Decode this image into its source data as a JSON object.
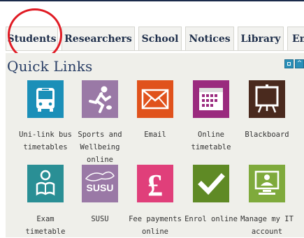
{
  "tabs": [
    {
      "label": "Students",
      "active": true
    },
    {
      "label": "Researchers",
      "active": false
    },
    {
      "label": "School",
      "active": false
    },
    {
      "label": "Notices",
      "active": false
    },
    {
      "label": "Library",
      "active": false
    },
    {
      "label": "Ema",
      "active": false
    }
  ],
  "panel": {
    "title": "Quick Links",
    "buttons": {
      "minimize": "^"
    }
  },
  "links": [
    {
      "label_lines": [
        "Uni-link bus",
        "timetables"
      ],
      "icon": "bus-icon",
      "color": "#1b8fb8"
    },
    {
      "label_lines": [
        "Sports and",
        "Wellbeing",
        "online booking"
      ],
      "icon": "runner-icon",
      "color": "#9a79a6"
    },
    {
      "label_lines": [
        "Email"
      ],
      "icon": "envelope-icon",
      "color": "#e0521c"
    },
    {
      "label_lines": [
        "Online",
        "timetable"
      ],
      "icon": "calendar-icon",
      "color": "#9a2a7e"
    },
    {
      "label_lines": [
        "Blackboard"
      ],
      "icon": "blackboard-icon",
      "color": "#4a2a1e"
    },
    {
      "label_lines": [
        "Exam timetable"
      ],
      "icon": "reading-person-icon",
      "color": "#2a8f95"
    },
    {
      "label_lines": [
        "SUSU"
      ],
      "icon": "susu-logo-icon",
      "color": "#9a79a6",
      "logo_text": "SUSU"
    },
    {
      "label_lines": [
        "Fee payments",
        "online"
      ],
      "icon": "pound-icon",
      "color": "#e03f7a",
      "glyph": "£"
    },
    {
      "label_lines": [
        "Enrol online"
      ],
      "icon": "checkmark-icon",
      "color": "#5f8a25"
    },
    {
      "label_lines": [
        "Manage my IT",
        "account"
      ],
      "icon": "computer-user-icon",
      "color": "#7faa3c"
    }
  ]
}
